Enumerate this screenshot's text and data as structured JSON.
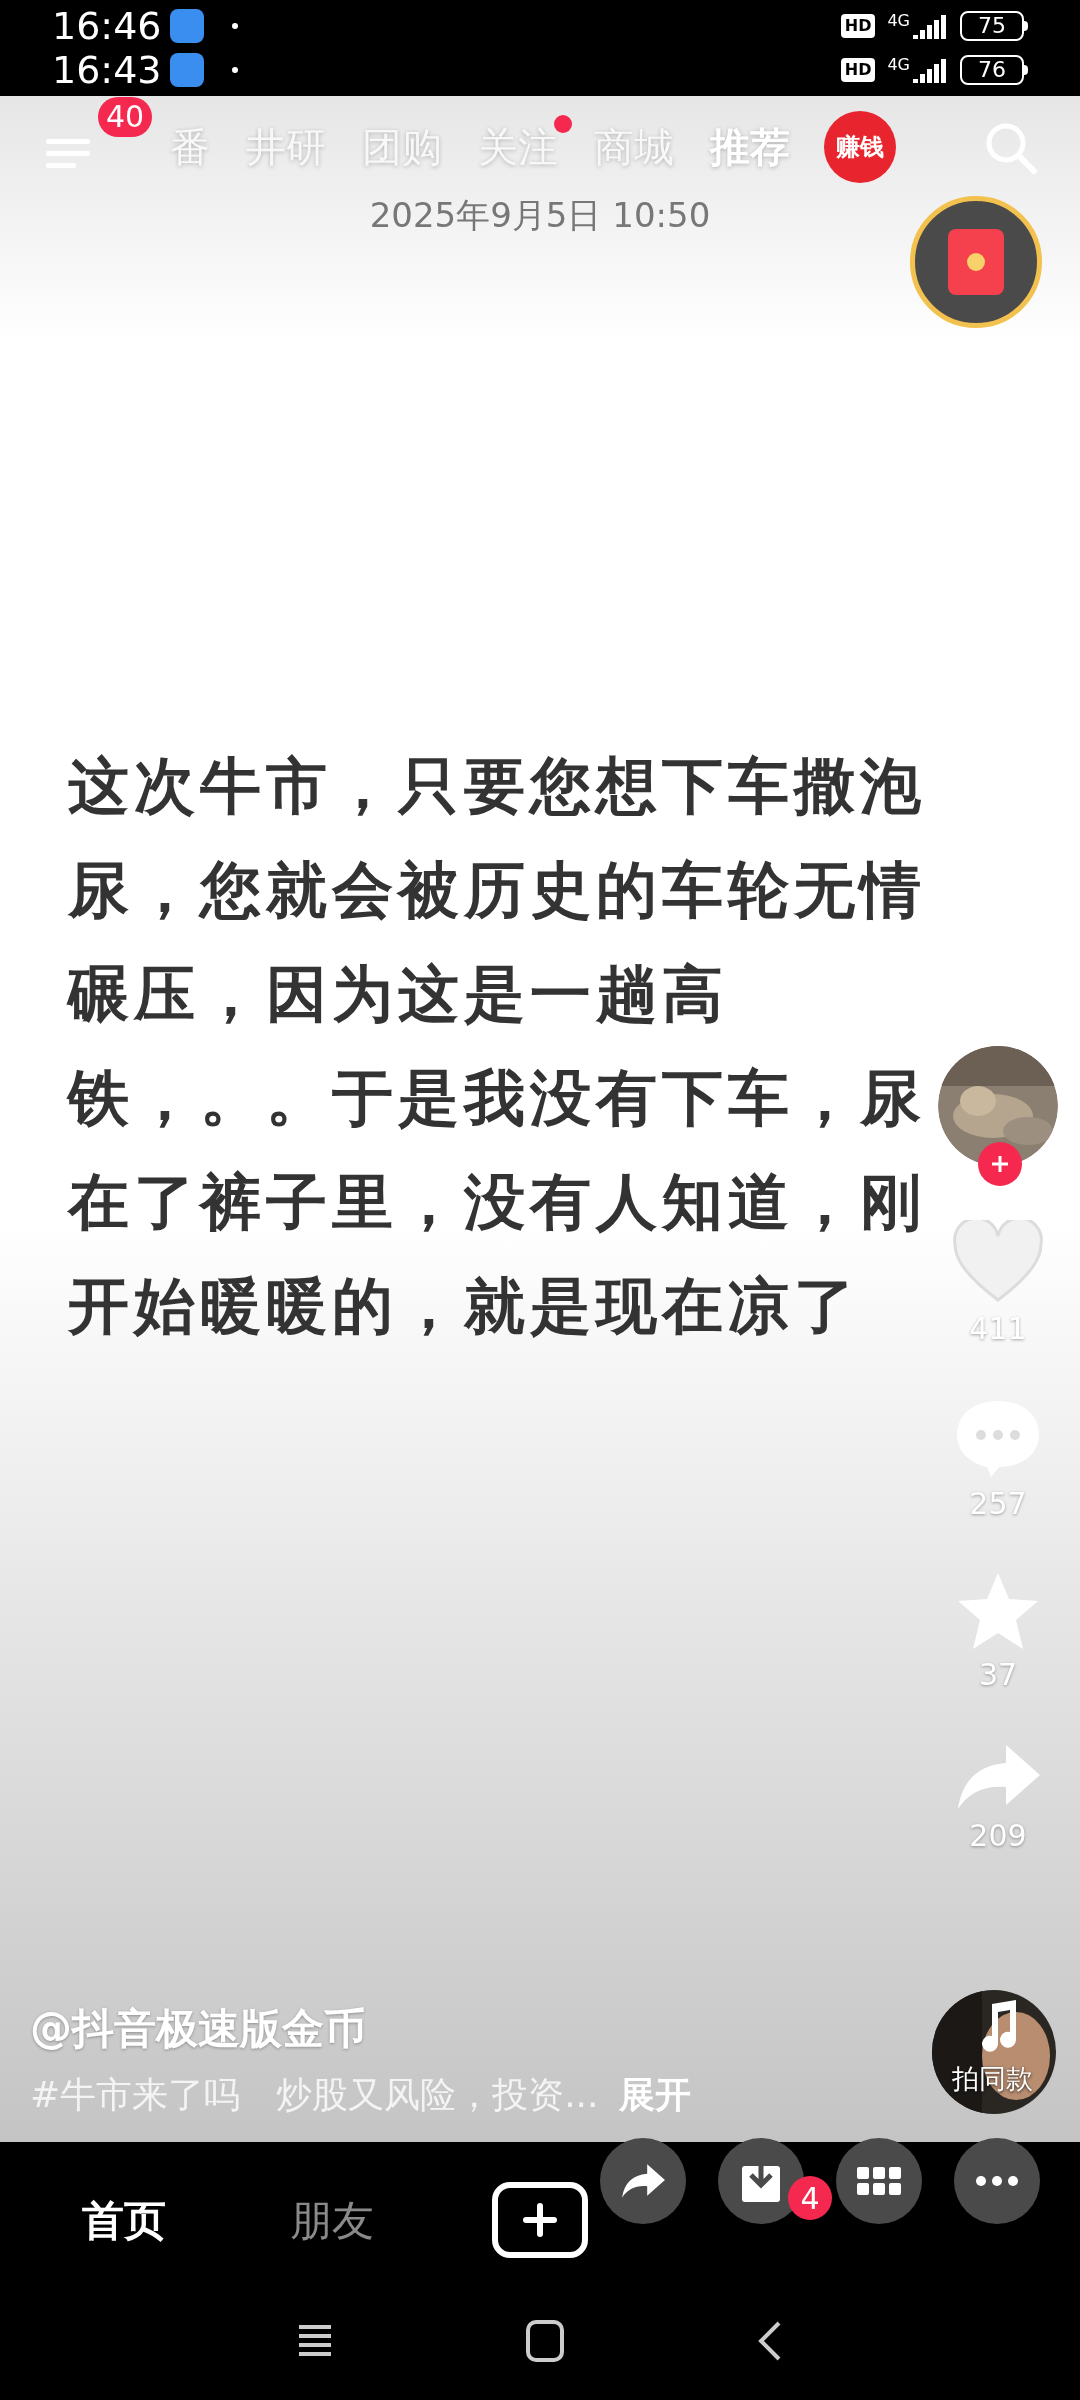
{
  "status_bars": [
    {
      "time": "16:46",
      "network": "4G",
      "hd": "HD",
      "battery": "75"
    },
    {
      "time": "16:43",
      "network": "4G",
      "hd": "HD",
      "battery": "76"
    }
  ],
  "top_nav": {
    "badge": "40",
    "tabs": [
      {
        "label": "番",
        "selected": false,
        "dot": false
      },
      {
        "label": "井研",
        "selected": false,
        "dot": false
      },
      {
        "label": "团购",
        "selected": false,
        "dot": false
      },
      {
        "label": "关注",
        "selected": false,
        "dot": true
      },
      {
        "label": "商城",
        "selected": false,
        "dot": false
      },
      {
        "label": "推荐",
        "selected": true,
        "dot": false
      }
    ],
    "earn": "赚钱",
    "date": "2025年9月5日 10:50"
  },
  "post": {
    "text": "这次牛市，只要您想下车撒泡尿，您就会被历史的车轮无情碾压，因为这是一趟高铁，。。于是我没有下车，尿在了裤子里，没有人知道，刚开始暖暖的，就是现在凉了"
  },
  "side_rail": {
    "likes": "411",
    "comments": "257",
    "favorites": "37",
    "shares": "209",
    "music_label": "拍同款"
  },
  "caption": {
    "author": "@抖音极速版金币",
    "description": "#牛市来了吗　炒股又风险，投资...",
    "expand": "展开"
  },
  "bottom_nav": {
    "tabs": [
      {
        "label": "首页",
        "selected": true
      },
      {
        "label": "朋友",
        "selected": false
      }
    ],
    "download_badge": "4"
  }
}
